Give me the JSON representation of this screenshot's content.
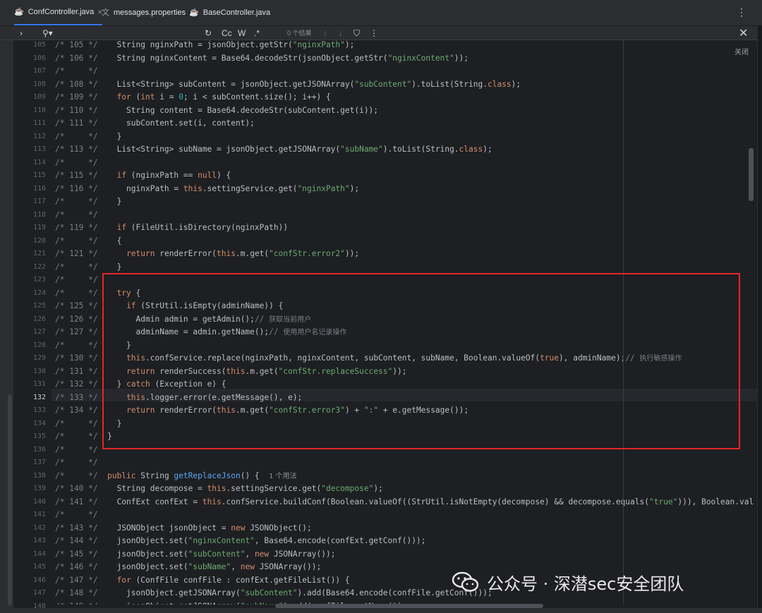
{
  "tabs": [
    {
      "label": "ConfController.java",
      "icon": "java-class-icon",
      "active": true
    },
    {
      "label": "messages.properties",
      "icon": "translate-icon",
      "active": false
    },
    {
      "label": "BaseController.java",
      "icon": "java-class-icon",
      "active": false
    }
  ],
  "find": {
    "results": "0 个结果",
    "toggles": [
      "Cc",
      "W",
      ".*"
    ]
  },
  "close_label": "关闭",
  "watermark": "公众号 · 深潜sec安全团队",
  "lines": [
    {
      "n": "105",
      "m": "/* 105 */",
      "code": [
        [
          "String nginxPath = jsonObject.getStr(",
          "p"
        ],
        [
          "\"nginxPath\"",
          "s"
        ],
        [
          ");",
          "p"
        ]
      ]
    },
    {
      "n": "106",
      "m": "/* 106 */",
      "code": [
        [
          "String nginxContent = Base64.decodeStr(jsonObject.getStr(",
          "p"
        ],
        [
          "\"nginxContent\"",
          "s"
        ],
        [
          "));",
          "p"
        ]
      ]
    },
    {
      "n": "107",
      "m": "/*     */",
      "code": []
    },
    {
      "n": "108",
      "m": "/* 108 */",
      "code": [
        [
          "List<String> subContent = jsonObject.getJSONArray(",
          "p"
        ],
        [
          "\"subContent\"",
          "s"
        ],
        [
          ").toList(String.",
          "p"
        ],
        [
          "class",
          "k"
        ],
        [
          ");",
          "p"
        ]
      ]
    },
    {
      "n": "109",
      "m": "/* 109 */",
      "code": [
        [
          "for",
          "k"
        ],
        [
          " (",
          "p"
        ],
        [
          "int",
          "k"
        ],
        [
          " i = ",
          "p"
        ],
        [
          "0",
          "n"
        ],
        [
          "; i < subContent.size(); i++) {",
          "p"
        ]
      ]
    },
    {
      "n": "110",
      "m": "/* 110 */",
      "code": [
        [
          "  String content = Base64.decodeStr(subContent.get(i));",
          "p"
        ]
      ]
    },
    {
      "n": "111",
      "m": "/* 111 */",
      "code": [
        [
          "  subContent.set(i, content);",
          "p"
        ]
      ]
    },
    {
      "n": "112",
      "m": "/*     */",
      "code": [
        [
          "}",
          "p"
        ]
      ]
    },
    {
      "n": "113",
      "m": "/* 113 */",
      "code": [
        [
          "List<String> subName = jsonObject.getJSONArray(",
          "p"
        ],
        [
          "\"subName\"",
          "s"
        ],
        [
          ").toList(String.",
          "p"
        ],
        [
          "class",
          "k"
        ],
        [
          ");",
          "p"
        ]
      ]
    },
    {
      "n": "114",
      "m": "/*     */",
      "code": []
    },
    {
      "n": "115",
      "m": "/* 115 */",
      "code": [
        [
          "if",
          "k"
        ],
        [
          " (nginxPath == ",
          "p"
        ],
        [
          "null",
          "k"
        ],
        [
          ") {",
          "p"
        ]
      ]
    },
    {
      "n": "116",
      "m": "/* 116 */",
      "code": [
        [
          "  nginxPath = ",
          "p"
        ],
        [
          "this",
          "k"
        ],
        [
          ".settingService.get(",
          "p"
        ],
        [
          "\"nginxPath\"",
          "s"
        ],
        [
          ");",
          "p"
        ]
      ]
    },
    {
      "n": "117",
      "m": "/*     */",
      "code": [
        [
          "}",
          "p"
        ]
      ]
    },
    {
      "n": "118",
      "m": "/*     */",
      "code": []
    },
    {
      "n": "119",
      "m": "/* 119 */",
      "code": [
        [
          "if",
          "k"
        ],
        [
          " (FileUtil.isDirectory(nginxPath))",
          "p"
        ]
      ]
    },
    {
      "n": "120",
      "m": "/*     */",
      "code": [
        [
          "{",
          "p"
        ]
      ]
    },
    {
      "n": "121",
      "m": "/* 121 */",
      "code": [
        [
          "  ",
          "p"
        ],
        [
          "return",
          "k"
        ],
        [
          " renderError(",
          "p"
        ],
        [
          "this",
          "k"
        ],
        [
          ".m.get(",
          "p"
        ],
        [
          "\"confStr.error2\"",
          "s"
        ],
        [
          "));",
          "p"
        ]
      ]
    },
    {
      "n": "122",
      "m": "/*     */",
      "code": [
        [
          "}",
          "p"
        ]
      ]
    },
    {
      "n": "123",
      "m": "/*     */",
      "code": []
    },
    {
      "n": "124",
      "m": "/*     */",
      "code": [
        [
          "try",
          "k"
        ],
        [
          " {",
          "p"
        ]
      ]
    },
    {
      "n": "125",
      "m": "/* 125 */",
      "code": [
        [
          "  ",
          "p"
        ],
        [
          "if",
          "k"
        ],
        [
          " (StrUtil.isEmpty(adminName)) {",
          "p"
        ]
      ]
    },
    {
      "n": "126",
      "m": "/* 126 */",
      "code": [
        [
          "    Admin admin = getAdmin();",
          "p"
        ],
        [
          "// ",
          "c"
        ],
        [
          "获取当前用户",
          "z"
        ]
      ]
    },
    {
      "n": "127",
      "m": "/* 127 */",
      "code": [
        [
          "    adminName = admin.getName();",
          "p"
        ],
        [
          "// ",
          "c"
        ],
        [
          "使用用户名记录操作",
          "z"
        ]
      ]
    },
    {
      "n": "128",
      "m": "/*     */",
      "code": [
        [
          "  }",
          "p"
        ]
      ]
    },
    {
      "n": "129",
      "m": "/* 130 */",
      "code": [
        [
          "  ",
          "p"
        ],
        [
          "this",
          "k"
        ],
        [
          ".confService.replace(nginxPath, nginxContent, subContent, subName, Boolean.valueOf(",
          "p"
        ],
        [
          "true",
          "k"
        ],
        [
          "), adminName);",
          "p"
        ],
        [
          "// ",
          "c"
        ],
        [
          "执行敏感操作",
          "z"
        ]
      ]
    },
    {
      "n": "130",
      "m": "/* 131 */",
      "code": [
        [
          "  ",
          "p"
        ],
        [
          "return",
          "k"
        ],
        [
          " renderSuccess(",
          "p"
        ],
        [
          "this",
          "k"
        ],
        [
          ".m.get(",
          "p"
        ],
        [
          "\"confStr.replaceSuccess\"",
          "s"
        ],
        [
          "));",
          "p"
        ]
      ]
    },
    {
      "n": "131",
      "m": "/* 132 */",
      "code": [
        [
          "} ",
          "p"
        ],
        [
          "catch",
          "k"
        ],
        [
          " (Exception e) {",
          "p"
        ]
      ]
    },
    {
      "n": "132",
      "m": "/* 133 */",
      "code": [
        [
          "  ",
          "p"
        ],
        [
          "this",
          "k"
        ],
        [
          ".logger.error(e.getMessage(), e);",
          "p"
        ]
      ]
    },
    {
      "n": "133",
      "m": "/* 134 */",
      "code": [
        [
          "  ",
          "p"
        ],
        [
          "return",
          "k"
        ],
        [
          " renderError(",
          "p"
        ],
        [
          "this",
          "k"
        ],
        [
          ".m.get(",
          "p"
        ],
        [
          "\"confStr.error3\"",
          "s"
        ],
        [
          ") + ",
          "p"
        ],
        [
          "\":\"",
          "s"
        ],
        [
          " + e.getMessage());",
          "p"
        ]
      ]
    },
    {
      "n": "134",
      "m": "/*     */",
      "code": [
        [
          "}",
          "p"
        ]
      ]
    },
    {
      "n": "135",
      "m": "/*     */",
      "code": [
        [
          "}",
          "p"
        ]
      ]
    },
    {
      "n": "136",
      "m": "/*     */",
      "code": []
    },
    {
      "n": "137",
      "m": "/*     */",
      "code": []
    },
    {
      "n": "138",
      "m": "/*     */",
      "code": [
        [
          "public",
          "k"
        ],
        [
          " String ",
          "p"
        ],
        [
          "getReplaceJson",
          "f"
        ],
        [
          "() {  ",
          "p"
        ],
        [
          "1 个用法",
          "h"
        ]
      ]
    },
    {
      "n": "139",
      "m": "/* 140 */",
      "code": [
        [
          "  String decompose = ",
          "p"
        ],
        [
          "this",
          "k"
        ],
        [
          ".settingService.get(",
          "p"
        ],
        [
          "\"decompose\"",
          "s"
        ],
        [
          ");",
          "p"
        ]
      ]
    },
    {
      "n": "140",
      "m": "/* 141 */",
      "code": [
        [
          "  ConfExt confExt = ",
          "p"
        ],
        [
          "this",
          "k"
        ],
        [
          ".confService.buildConf(Boolean.valueOf((StrUtil.isNotEmpty(decompose) && decompose.equals(",
          "p"
        ],
        [
          "\"true\"",
          "s"
        ],
        [
          "))), Boolean.val",
          "p"
        ]
      ]
    },
    {
      "n": "141",
      "m": "/*     */",
      "code": []
    },
    {
      "n": "142",
      "m": "/* 143 */",
      "code": [
        [
          "  JSONObject jsonObject = ",
          "p"
        ],
        [
          "new",
          "k"
        ],
        [
          " JSONObject();",
          "p"
        ]
      ]
    },
    {
      "n": "143",
      "m": "/* 144 */",
      "code": [
        [
          "  jsonObject.set(",
          "p"
        ],
        [
          "\"nginxContent\"",
          "s"
        ],
        [
          ", Base64.encode(confExt.getConf()));",
          "p"
        ]
      ]
    },
    {
      "n": "144",
      "m": "/* 145 */",
      "code": [
        [
          "  jsonObject.set(",
          "p"
        ],
        [
          "\"subContent\"",
          "s"
        ],
        [
          ", ",
          "p"
        ],
        [
          "new",
          "k"
        ],
        [
          " JSONArray());",
          "p"
        ]
      ]
    },
    {
      "n": "145",
      "m": "/* 146 */",
      "code": [
        [
          "  jsonObject.set(",
          "p"
        ],
        [
          "\"subName\"",
          "s"
        ],
        [
          ", ",
          "p"
        ],
        [
          "new",
          "k"
        ],
        [
          " JSONArray());",
          "p"
        ]
      ]
    },
    {
      "n": "146",
      "m": "/* 147 */",
      "code": [
        [
          "  ",
          "p"
        ],
        [
          "for",
          "k"
        ],
        [
          " (ConfFile confFile : confExt.getFileList()) {",
          "p"
        ]
      ]
    },
    {
      "n": "147",
      "m": "/* 148 */",
      "code": [
        [
          "    jsonObject.getJSONArray(",
          "p"
        ],
        [
          "\"subContent\"",
          "s"
        ],
        [
          ").add(Base64.encode(confFile.getConf()));",
          "p"
        ]
      ]
    },
    {
      "n": "148",
      "m": "/* 149 */",
      "code": [
        [
          "    jsonObject.getJSONArray(",
          "p"
        ],
        [
          "\"subName\"",
          "s"
        ],
        [
          ").add(confFile.getName());",
          "p"
        ]
      ]
    }
  ]
}
